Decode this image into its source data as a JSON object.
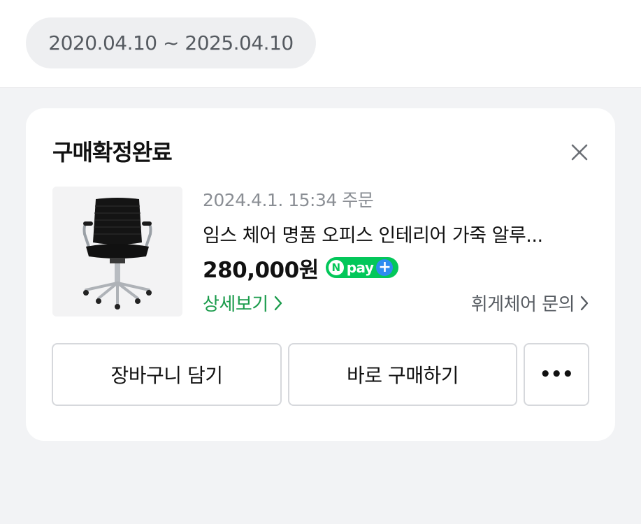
{
  "period": {
    "range": "2020.04.10 ~ 2025.04.10"
  },
  "card": {
    "title": "구매확정완료",
    "order_meta": "2024.4.1. 15:34 주문",
    "product_name": "임스 체어 명품 오피스 인테리어 가죽 알루...",
    "price": "280,000원",
    "npay_label": "pay",
    "detail_link": "상세보기",
    "inquiry_link": "휘게체어 문의",
    "buttons": {
      "cart": "장바구니 담기",
      "buy": "바로 구매하기",
      "more": "•••"
    }
  },
  "colors": {
    "accent_green": "#1a9b4b",
    "npay_green": "#03c75a",
    "background": "#f2f3f5"
  }
}
